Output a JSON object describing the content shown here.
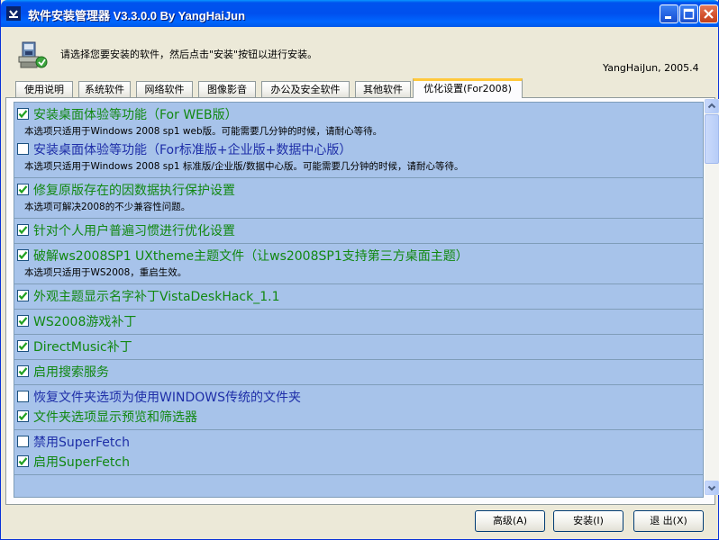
{
  "window": {
    "title": "软件安装管理器 V3.3.0.0 By YangHaiJun"
  },
  "header": {
    "instruction": "请选择您要安装的软件，然后点击\"安装\"按钮以进行安装。",
    "author": "YangHaiJun, 2005.4",
    "icon": "installer-icon"
  },
  "tabs": [
    {
      "label": "使用说明"
    },
    {
      "label": "系统软件"
    },
    {
      "label": "网络软件"
    },
    {
      "label": "图像影音"
    },
    {
      "label": "办公及安全软件"
    },
    {
      "label": "其他软件"
    },
    {
      "label": "优化设置(For2008)",
      "active": true
    }
  ],
  "groups": [
    {
      "items": [
        {
          "label": "安装桌面体验等功能（For WEB版）",
          "checked": true,
          "desc": "本选项只适用于Windows 2008 sp1 web版。可能需要几分钟的时候，请耐心等待。"
        },
        {
          "label": "安装桌面体验等功能（For标准版+企业版+数据中心版）",
          "checked": false,
          "desc": "本选项只适用于Windows 2008 sp1 标准版/企业版/数据中心版。可能需要几分钟的时候，请耐心等待。"
        }
      ]
    },
    {
      "items": [
        {
          "label": "修复原版存在的因数据执行保护设置",
          "checked": true,
          "desc": "本选项可解决2008的不少兼容性问题。"
        }
      ]
    },
    {
      "items": [
        {
          "label": "针对个人用户普遍习惯进行优化设置",
          "checked": true,
          "desc": ""
        }
      ]
    },
    {
      "items": [
        {
          "label": "破解ws2008SP1 UXtheme主题文件（让ws2008SP1支持第三方桌面主题）",
          "checked": true,
          "desc": "本选项只适用于WS2008，重启生效。"
        }
      ]
    },
    {
      "items": [
        {
          "label": "外观主题显示名字补丁VistaDeskHack_1.1",
          "checked": true,
          "desc": ""
        }
      ]
    },
    {
      "items": [
        {
          "label": "WS2008游戏补丁",
          "checked": true,
          "desc": ""
        }
      ]
    },
    {
      "items": [
        {
          "label": "DirectMusic补丁",
          "checked": true,
          "desc": ""
        }
      ]
    },
    {
      "items": [
        {
          "label": "启用搜索服务",
          "checked": true,
          "desc": ""
        }
      ]
    },
    {
      "items": [
        {
          "label": "恢复文件夹选项为使用WINDOWS传统的文件夹",
          "checked": false,
          "desc": ""
        },
        {
          "label": "文件夹选项显示预览和筛选器",
          "checked": true,
          "desc": ""
        }
      ]
    },
    {
      "items": [
        {
          "label": "禁用SuperFetch",
          "checked": false,
          "desc": ""
        },
        {
          "label": "启用SuperFetch",
          "checked": true,
          "desc": ""
        }
      ]
    }
  ],
  "buttons": {
    "advanced": "高级(A)",
    "install": "安装(I)",
    "exit": "退 出(X)"
  },
  "colors": {
    "titlebar": "#0054E3",
    "list_bg": "#A7C3EA",
    "checked_text": "#118811",
    "unchecked_text": "#1E2EA8",
    "active_tab_accent": "#FFC83C"
  }
}
